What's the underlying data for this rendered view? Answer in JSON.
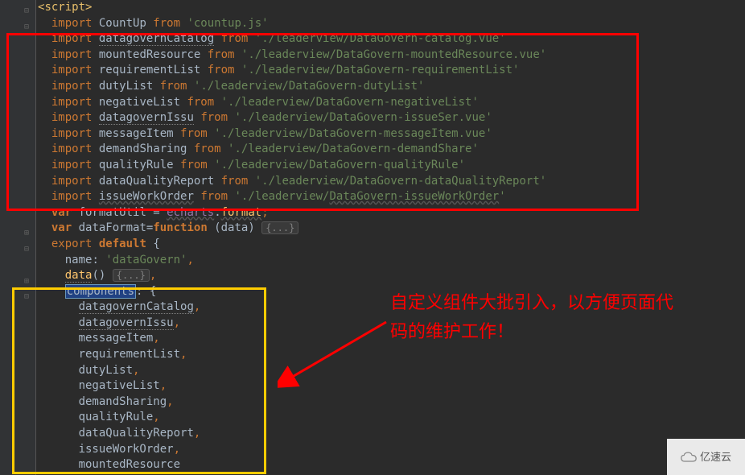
{
  "lines": [
    {
      "indent": 0,
      "seg": [
        {
          "t": "<",
          "c": "tag"
        },
        {
          "t": "script",
          "c": "tag"
        },
        {
          "t": ">",
          "c": "tag"
        }
      ]
    },
    {
      "indent": 1,
      "seg": [
        {
          "t": "import",
          "c": "kw"
        },
        {
          "t": " CountUp ",
          "c": "ident"
        },
        {
          "t": "from",
          "c": "kw"
        },
        {
          "t": " ",
          "c": ""
        },
        {
          "t": "'countup.js'",
          "c": "str"
        }
      ]
    },
    {
      "indent": 1,
      "seg": [
        {
          "t": "import",
          "c": "kw"
        },
        {
          "t": " ",
          "c": ""
        },
        {
          "t": "datagovernCatalog",
          "c": "underline"
        },
        {
          "t": " ",
          "c": ""
        },
        {
          "t": "from",
          "c": "kw"
        },
        {
          "t": " ",
          "c": ""
        },
        {
          "t": "'./leaderview/DataGovern-catalog.vue'",
          "c": "str"
        }
      ]
    },
    {
      "indent": 1,
      "seg": [
        {
          "t": "import",
          "c": "kw"
        },
        {
          "t": " mountedResource ",
          "c": "ident"
        },
        {
          "t": "from",
          "c": "kw"
        },
        {
          "t": " ",
          "c": ""
        },
        {
          "t": "'./leaderview/DataGovern-mountedResource.vue'",
          "c": "str"
        }
      ]
    },
    {
      "indent": 1,
      "seg": [
        {
          "t": "import",
          "c": "kw"
        },
        {
          "t": " requirementList ",
          "c": "ident"
        },
        {
          "t": "from",
          "c": "kw"
        },
        {
          "t": " ",
          "c": ""
        },
        {
          "t": "'./leaderview/DataGovern-requirementList'",
          "c": "str"
        }
      ]
    },
    {
      "indent": 1,
      "seg": [
        {
          "t": "import",
          "c": "kw"
        },
        {
          "t": " dutyList ",
          "c": "ident"
        },
        {
          "t": "from",
          "c": "kw"
        },
        {
          "t": " ",
          "c": ""
        },
        {
          "t": "'./leaderview/DataGovern-dutyList'",
          "c": "str"
        }
      ]
    },
    {
      "indent": 1,
      "seg": [
        {
          "t": "import",
          "c": "kw"
        },
        {
          "t": " negativeList ",
          "c": "ident"
        },
        {
          "t": "from",
          "c": "kw"
        },
        {
          "t": " ",
          "c": ""
        },
        {
          "t": "'./leaderview/DataGovern-negativeList'",
          "c": "str"
        }
      ]
    },
    {
      "indent": 1,
      "seg": [
        {
          "t": "import",
          "c": "kw"
        },
        {
          "t": " ",
          "c": ""
        },
        {
          "t": "datagovernIssu",
          "c": "underline"
        },
        {
          "t": " ",
          "c": ""
        },
        {
          "t": "from",
          "c": "kw"
        },
        {
          "t": " ",
          "c": ""
        },
        {
          "t": "'./leaderview/DataGovern-issueSer.vue'",
          "c": "str"
        }
      ]
    },
    {
      "indent": 1,
      "seg": [
        {
          "t": "import",
          "c": "kw"
        },
        {
          "t": " messageItem ",
          "c": "ident"
        },
        {
          "t": "from",
          "c": "kw"
        },
        {
          "t": " ",
          "c": ""
        },
        {
          "t": "'./leaderview/DataGovern-messageItem.vue'",
          "c": "str"
        }
      ]
    },
    {
      "indent": 1,
      "seg": [
        {
          "t": "import",
          "c": "kw"
        },
        {
          "t": " demandSharing ",
          "c": "ident"
        },
        {
          "t": "from",
          "c": "kw"
        },
        {
          "t": " ",
          "c": ""
        },
        {
          "t": "'./leaderview/DataGovern-demandShare'",
          "c": "str"
        }
      ]
    },
    {
      "indent": 1,
      "seg": [
        {
          "t": "import",
          "c": "kw"
        },
        {
          "t": " qualityRule ",
          "c": "ident"
        },
        {
          "t": "from",
          "c": "kw"
        },
        {
          "t": " ",
          "c": ""
        },
        {
          "t": "'./leaderview/DataGovern-qualityRule'",
          "c": "str"
        }
      ]
    },
    {
      "indent": 1,
      "seg": [
        {
          "t": "import",
          "c": "kw"
        },
        {
          "t": " dataQualityReport ",
          "c": "ident"
        },
        {
          "t": "from",
          "c": "kw"
        },
        {
          "t": " ",
          "c": ""
        },
        {
          "t": "'./leaderview/DataGovern-dataQualityReport'",
          "c": "str"
        }
      ]
    },
    {
      "indent": 1,
      "seg": [
        {
          "t": "import",
          "c": "kw"
        },
        {
          "t": " ",
          "c": ""
        },
        {
          "t": "issueWorkOrder",
          "c": "gray-wave"
        },
        {
          "t": " ",
          "c": ""
        },
        {
          "t": "from",
          "c": "kw"
        },
        {
          "t": " ",
          "c": ""
        },
        {
          "t": "'./leaderview/",
          "c": "str"
        },
        {
          "t": "DataGovern-issueWorkOrder",
          "c": "str gray-wave"
        },
        {
          "t": "'",
          "c": "str"
        }
      ]
    },
    {
      "indent": 1,
      "seg": [
        {
          "t": "var",
          "c": "kw-b"
        },
        {
          "t": " formatUtil = ",
          "c": "ident"
        },
        {
          "t": "echarts",
          "c": "ec gray-wave"
        },
        {
          "t": ".",
          "c": "ident"
        },
        {
          "t": "format",
          "c": "fn gray-wave"
        },
        {
          "t": ";",
          "c": "punct"
        }
      ]
    },
    {
      "indent": 1,
      "seg": [
        {
          "t": "var",
          "c": "kw-b"
        },
        {
          "t": " dataFormat=",
          "c": "ident"
        },
        {
          "t": "function",
          "c": "kw-b"
        },
        {
          "t": " (data) ",
          "c": "ident"
        },
        {
          "t": "{...}",
          "c": "folded"
        }
      ]
    },
    {
      "indent": 1,
      "seg": [
        {
          "t": "export ",
          "c": "kw"
        },
        {
          "t": "default",
          "c": "kw-b"
        },
        {
          "t": " {",
          "c": "ident"
        }
      ]
    },
    {
      "indent": 2,
      "seg": [
        {
          "t": "name",
          "c": "ident"
        },
        {
          "t": ": ",
          "c": "ident"
        },
        {
          "t": "'dataGovern'",
          "c": "str"
        },
        {
          "t": ",",
          "c": "punct"
        }
      ]
    },
    {
      "indent": 2,
      "seg": [
        {
          "t": "data",
          "c": "fn underline"
        },
        {
          "t": "() ",
          "c": "ident"
        },
        {
          "t": "{...}",
          "c": "folded"
        },
        {
          "t": ",",
          "c": "punct"
        }
      ]
    },
    {
      "indent": 2,
      "seg": [
        {
          "t": "components",
          "c": "hlbox"
        },
        {
          "t": ": {",
          "c": "ident"
        }
      ]
    },
    {
      "indent": 3,
      "seg": [
        {
          "t": "datagovernCatalog",
          "c": "underline"
        },
        {
          "t": ",",
          "c": "punct"
        }
      ]
    },
    {
      "indent": 3,
      "seg": [
        {
          "t": "datagovernIssu",
          "c": "underline"
        },
        {
          "t": ",",
          "c": "punct"
        }
      ]
    },
    {
      "indent": 3,
      "seg": [
        {
          "t": "messageItem",
          "c": "ident"
        },
        {
          "t": ",",
          "c": "punct"
        }
      ]
    },
    {
      "indent": 3,
      "seg": [
        {
          "t": "requirementList",
          "c": "ident"
        },
        {
          "t": ",",
          "c": "punct"
        }
      ]
    },
    {
      "indent": 3,
      "seg": [
        {
          "t": "dutyList",
          "c": "ident"
        },
        {
          "t": ",",
          "c": "punct"
        }
      ]
    },
    {
      "indent": 3,
      "seg": [
        {
          "t": "negativeList",
          "c": "ident"
        },
        {
          "t": ",",
          "c": "punct"
        }
      ]
    },
    {
      "indent": 3,
      "seg": [
        {
          "t": "demandSharing",
          "c": "ident"
        },
        {
          "t": ",",
          "c": "punct"
        }
      ]
    },
    {
      "indent": 3,
      "seg": [
        {
          "t": "qualityRule",
          "c": "ident"
        },
        {
          "t": ",",
          "c": "punct"
        }
      ]
    },
    {
      "indent": 3,
      "seg": [
        {
          "t": "dataQualityReport",
          "c": "ident"
        },
        {
          "t": ",",
          "c": "punct"
        }
      ]
    },
    {
      "indent": 3,
      "seg": [
        {
          "t": "issueWorkOrder",
          "c": "ident"
        },
        {
          "t": ",",
          "c": "punct"
        }
      ]
    },
    {
      "indent": 3,
      "seg": [
        {
          "t": "mountedResource",
          "c": "ident"
        }
      ]
    }
  ],
  "annotation": {
    "line1": "自定义组件大批引入，以方便页面代",
    "line2": "码的维护工作！"
  },
  "watermark": "亿速云"
}
